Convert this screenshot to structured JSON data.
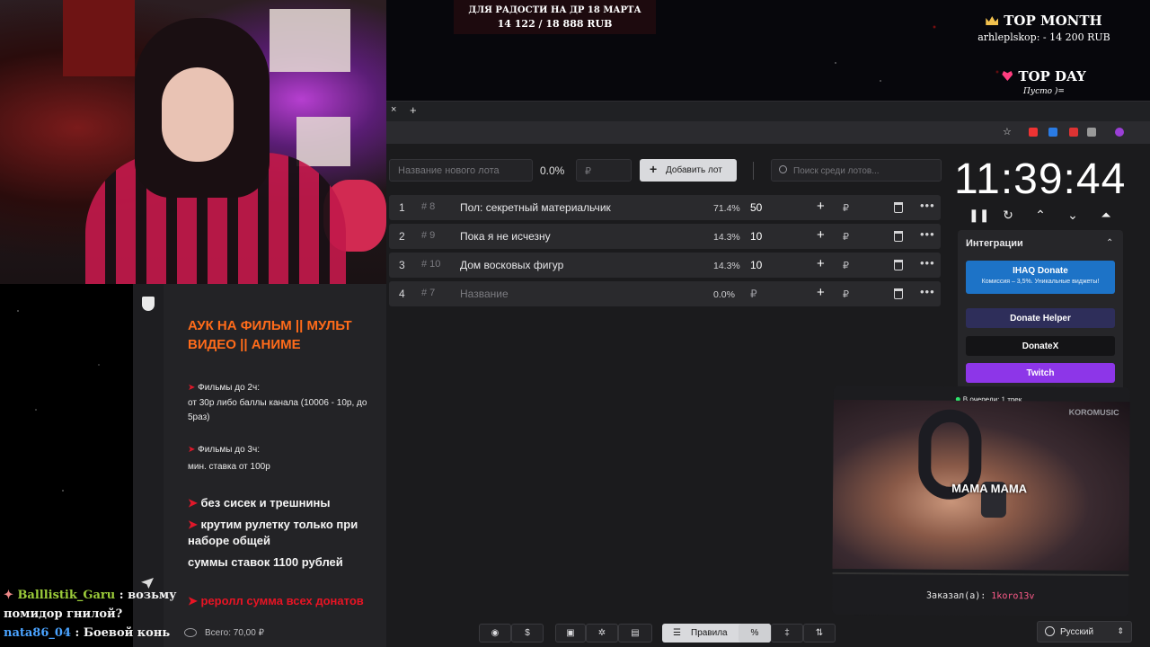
{
  "goal": {
    "title": "ДЛЯ РАДОСТИ НА ДР 18 МАРТА",
    "amount": "14 122 / 18 888 RUB"
  },
  "top_month": {
    "title": "TOP MONTH",
    "entry": "arhleplskop: - 14 200 RUB"
  },
  "top_day": {
    "title": "TOP DAY",
    "entry": "Пусто )="
  },
  "info": {
    "title": "АУК НА ФИЛЬМ || МУЛЬТ ВИДЕО || АНИМЕ",
    "films2_head": "Фильмы до 2ч:",
    "films2_text": "от 30р либо баллы канала (10006 - 10р, до 5раз)",
    "films3_head": "Фильмы до 3ч:",
    "films3_text": "мин. ставка от 100р",
    "rule1": "без сисек и трешнины",
    "rule2": "крутим рулетку только при наборе общей",
    "rule3": "суммы ставок 1100 рублей",
    "rule4": "реролл сумма всех донатов",
    "total": "Всего: 70,00 ₽"
  },
  "chat": [
    {
      "user": "Balllistik_Garu",
      "text": "возьму"
    },
    {
      "user": "",
      "text": "помидор гнилой?"
    },
    {
      "user": "nata86_04",
      "text": "Боевой конь"
    }
  ],
  "auction": {
    "new_lot_placeholder": "Название нового лота",
    "percent": "0.0%",
    "rub_placeholder": "₽",
    "add_lot_label": "Добавить лот",
    "search_placeholder": "Поиск среди лотов...",
    "lots": [
      {
        "index": "1",
        "id": "# 8",
        "name": "Пол: секретный материальчик",
        "percent": "71.4%",
        "amount": "50"
      },
      {
        "index": "2",
        "id": "# 9",
        "name": "Пока я не исчезну",
        "percent": "14.3%",
        "amount": "10"
      },
      {
        "index": "3",
        "id": "# 10",
        "name": "Дом восковых фигур",
        "percent": "14.3%",
        "amount": "10"
      },
      {
        "index": "4",
        "id": "# 7",
        "name": "Название",
        "percent": "0.0%",
        "amount": "₽"
      }
    ]
  },
  "timer": {
    "time": "11:39:44"
  },
  "integrations": {
    "title": "Интеграции",
    "ihaq": "IHAQ Donate",
    "ihaq_sub": "Комиссия – 3,5%. Уникальные виджеты!",
    "donate_helper": "Donate Helper",
    "donatex": "DonateX",
    "twitch": "Twitch"
  },
  "video": {
    "queue": "В очереди: 1 трек",
    "brand": "KOROMUSIC",
    "lyrics": "MAMA MAMA",
    "ordered_prefix": "Заказал(а):",
    "ordered_by": "1koro13v"
  },
  "toolbar": {
    "rules_label": "Правила",
    "percent_label": "%",
    "language": "Русский"
  },
  "colors": {
    "accent_orange": "#ff6b1a",
    "twitch": "#8d36e8",
    "ihaq": "#1d73c7",
    "red_arrow": "#e0182a"
  }
}
